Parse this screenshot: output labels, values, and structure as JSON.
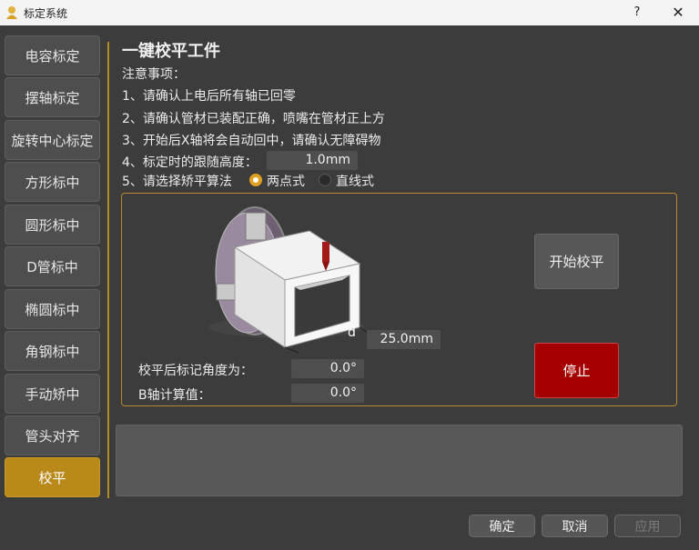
{
  "window": {
    "title": "标定系统",
    "help": "?",
    "close": "✕"
  },
  "sidebar": {
    "items": [
      {
        "label": "电容标定"
      },
      {
        "label": "摆轴标定"
      },
      {
        "label": "旋转中心标定"
      },
      {
        "label": "方形标中"
      },
      {
        "label": "圆形标中"
      },
      {
        "label": "D管标中"
      },
      {
        "label": "椭圆标中"
      },
      {
        "label": "角钢标中"
      },
      {
        "label": "手动矫中"
      },
      {
        "label": "管头对齐"
      },
      {
        "label": "校平"
      }
    ],
    "active_index": 10
  },
  "main": {
    "heading": "一键校平工件",
    "notes_title": "注意事项：",
    "notes": [
      "1、请确认上电后所有轴已回零",
      "2、请确认管材已装配正确，喷嘴在管材正上方",
      "3、开始后X轴将会自动回中，请确认无障碍物",
      "4、标定时的跟随高度：",
      "5、请选择矫平算法"
    ],
    "follow_height": "1.0mm",
    "algorithm": {
      "options": [
        "两点式",
        "直线式"
      ],
      "selected": "两点式"
    },
    "panel": {
      "dim_label": "d",
      "dim_value": "25.0mm",
      "angle_label": "校平后标记角度为：",
      "angle_value": "0.0°",
      "b_axis_label": "B轴计算值：",
      "b_axis_value": "0.0°",
      "start_label": "开始校平",
      "stop_label": "停止"
    }
  },
  "footer": {
    "ok": "确定",
    "cancel": "取消",
    "apply": "应用"
  },
  "colors": {
    "accent": "#b98a1a",
    "stop": "#a50000",
    "background": "#3c3c3c"
  }
}
